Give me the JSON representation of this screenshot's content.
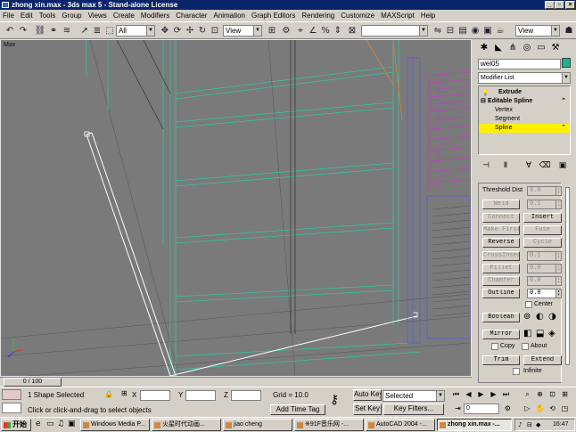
{
  "window": {
    "title": "zhong xin.max - 3ds max 5 - Stand-alone License"
  },
  "menu": [
    "File",
    "Edit",
    "Tools",
    "Group",
    "Views",
    "Create",
    "Modifiers",
    "Character",
    "Animation",
    "Graph Editors",
    "Rendering",
    "Customize",
    "MAXScript",
    "Help"
  ],
  "toolbar": {
    "selection_filter": "All",
    "coord_system": "View",
    "named_selection": "",
    "render_view": "View"
  },
  "viewport": {
    "label": "Max"
  },
  "command_panel": {
    "object_name": "wei05",
    "object_color": "#1cb28c",
    "modifier_list": "Modifier List",
    "stack": [
      {
        "label": "Extrude",
        "level": 0
      },
      {
        "label": "Editable Spline",
        "level": 0
      },
      {
        "label": "Vertex",
        "level": 1
      },
      {
        "label": "Segment",
        "level": 1
      },
      {
        "label": "Spline",
        "level": 1,
        "selected": true
      }
    ],
    "rollout": {
      "threshold_label": "Threshold Dist",
      "threshold_value": "6.0",
      "weld": "Weld",
      "weld_value": "0.1",
      "connect": "Connect",
      "insert": "Insert",
      "make_first": "Make First",
      "fuse": "Fuse",
      "reverse": "Reverse",
      "cycle": "Cycle",
      "crossinsert": "CrossInsert",
      "crossinsert_value": "0.1",
      "fillet": "Fillet",
      "fillet_value": "0.0",
      "chamfer": "Chamfer",
      "chamfer_value": "0.0",
      "outline": "Outline",
      "outline_value": "0.0",
      "center_label": "Center",
      "boolean": "Boolean",
      "mirror": "Mirror",
      "copy_label": "Copy",
      "about_label": "About",
      "trim": "Trim",
      "extend": "Extend",
      "infinite_label": "Infinite"
    }
  },
  "timeslider": {
    "label": "0 / 100"
  },
  "status": {
    "selection_info": "1 Shape Selected",
    "prompt": "Click or click-and-drag to select objects",
    "x_label": "X",
    "y_label": "Y",
    "z_label": "Z",
    "x_value": "",
    "y_value": "",
    "z_value": "",
    "grid": "Grid = 10.0",
    "add_time_tag": "Add Time Tag",
    "auto_key": "Auto Key",
    "set_key": "Set Key",
    "key_mode": "Selected",
    "key_filters": "Key Filters...",
    "frame": "0"
  },
  "taskbar": {
    "start": "开始",
    "tasks": [
      "Windows Media P...",
      "火星时代动画...",
      "jiao cheng",
      "※91F音乐网 -...",
      "AutoCAD 2004 -...",
      "zhong xin.max -..."
    ],
    "active_task": 5,
    "clock": "16:47"
  }
}
